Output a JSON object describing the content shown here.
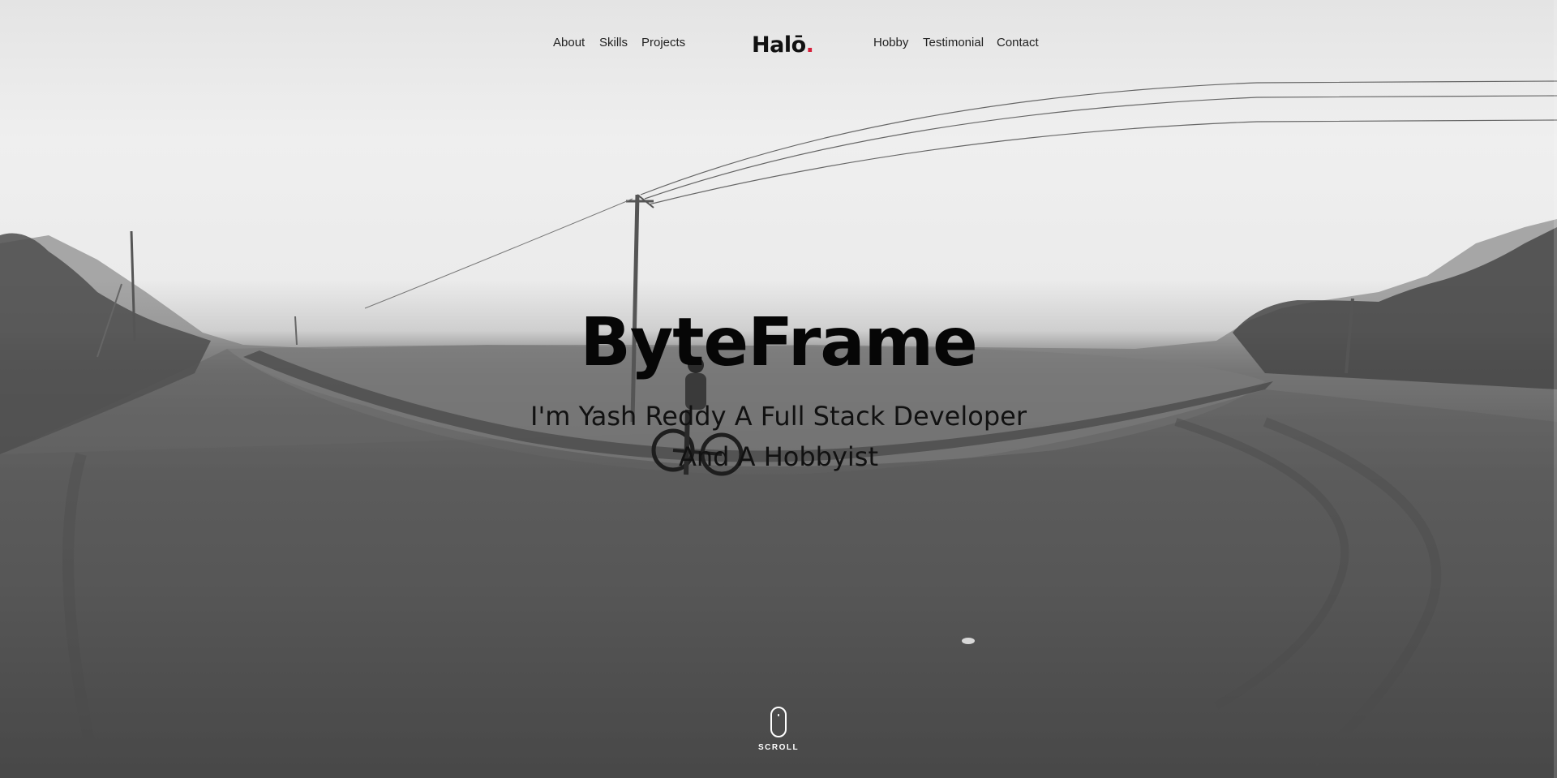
{
  "nav": {
    "left_items": [
      {
        "label": "About"
      },
      {
        "label": "Skills"
      },
      {
        "label": "Projects"
      }
    ],
    "logo": {
      "text": "Halō",
      "dot": ".",
      "dot_color": "#d51f3a"
    },
    "right_items": [
      {
        "label": "Hobby"
      },
      {
        "label": "Testimonial"
      },
      {
        "label": "Contact"
      }
    ]
  },
  "hero": {
    "title": "ByteFrame",
    "subtitle_line1": "I'm Yash Reddy A Full Stack Developer",
    "subtitle_line2": "And A Hobbyist",
    "background_image": "black-and-white-photo-of-person-with-bicycle-on-curved-dirt-road"
  },
  "scroll": {
    "label": "SCROLL",
    "icon": "mouse-icon"
  },
  "colors": {
    "accent": "#d51f3a",
    "text_dark": "#111111",
    "text_light": "#ffffff"
  }
}
